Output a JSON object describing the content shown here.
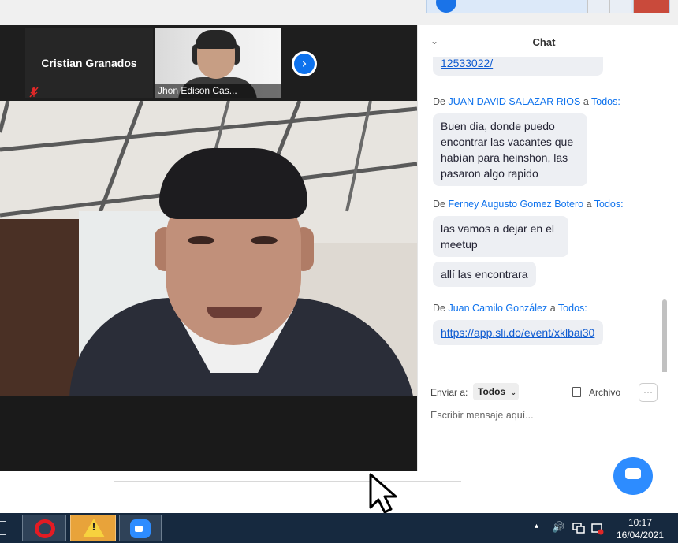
{
  "colors": {
    "accent": "#0e72ed",
    "chat_bubble": "#edeff3",
    "link": "#0e5bd1",
    "taskbar": "#16293f"
  },
  "gallery": {
    "tiles": [
      {
        "name": "Cristian Granados",
        "mic_icon": "mic-muted-icon"
      },
      {
        "name": "Jhon Edison Cas..."
      }
    ],
    "next_icon": "chevron-right-icon",
    "next_glyph": "›"
  },
  "chat": {
    "title": "Chat",
    "collapse_glyph": "⌄",
    "messages": [
      {
        "type": "link_tail",
        "text": "12533022/"
      },
      {
        "prefix": "De",
        "sender": "JUAN DAVID SALAZAR RIOS",
        "connector": "a",
        "recipient": "Todos:",
        "bubbles": [
          "Buen dia, donde puedo encontrar las vacantes que habían para heinshon, las pasaron algo rapido"
        ]
      },
      {
        "prefix": "De",
        "sender": "Ferney Augusto Gomez Botero",
        "connector": "a",
        "recipient": "Todos:",
        "bubbles": [
          "las vamos a dejar en el meetup",
          "allí las encontrara"
        ]
      },
      {
        "prefix": "De",
        "sender": "Juan Camilo González",
        "connector": "a",
        "recipient": "Todos:",
        "bubbles": [
          "https://app.sli.do/event/xklbai30"
        ]
      }
    ],
    "compose": {
      "send_to_label": "Enviar a:",
      "send_to_value": "Todos",
      "file_label": "Archivo",
      "more_label": "···",
      "placeholder": "Escribir mensaje aquí..."
    }
  },
  "taskbar": {
    "apps": [
      {
        "name": "opera",
        "icon": "opera-icon"
      },
      {
        "name": "warning",
        "icon": "warning-icon",
        "mark": "!"
      },
      {
        "name": "zoom",
        "icon": "zoom-icon"
      }
    ],
    "tray": {
      "chevron": "▴",
      "volume": "🔊"
    },
    "clock": {
      "time": "10:17",
      "date": "16/04/2021"
    }
  }
}
